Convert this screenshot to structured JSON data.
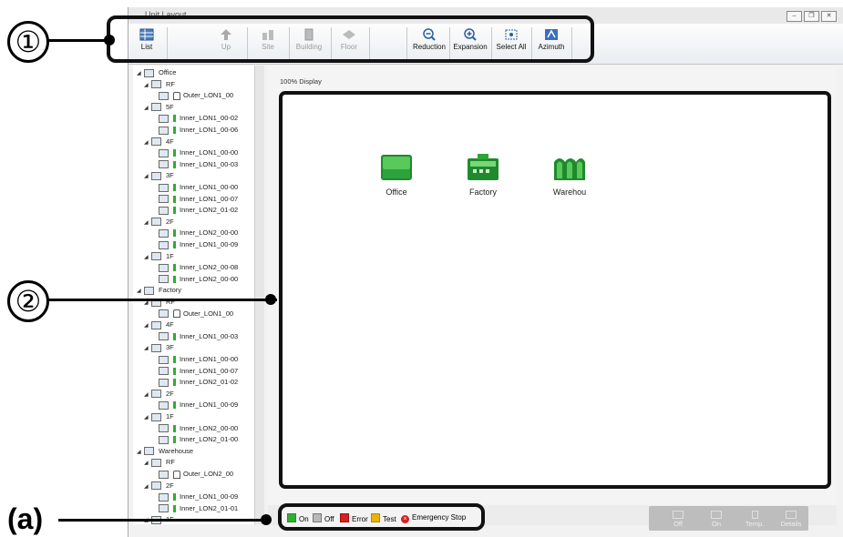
{
  "window": {
    "title": "Unit Layout",
    "controls": [
      "minimize-icon",
      "restore-icon",
      "close-icon"
    ]
  },
  "ribbon": {
    "buttons": [
      {
        "label": "List",
        "icon": "list-icon",
        "enabled": true
      },
      {
        "label": "Up",
        "icon": "up-arrow-icon",
        "enabled": false
      },
      {
        "label": "Site",
        "icon": "site-icon",
        "enabled": false
      },
      {
        "label": "Building",
        "icon": "building-icon",
        "enabled": false
      },
      {
        "label": "Floor",
        "icon": "floor-icon",
        "enabled": false
      },
      {
        "label": "Reduction",
        "icon": "zoom-out-icon",
        "enabled": true
      },
      {
        "label": "Expansion",
        "icon": "zoom-in-icon",
        "enabled": true
      },
      {
        "label": "Select All",
        "icon": "select-all-icon",
        "enabled": true
      },
      {
        "label": "Azimuth",
        "icon": "azimuth-icon",
        "enabled": true
      }
    ]
  },
  "tree": {
    "nodes": [
      {
        "label": "Office",
        "level": 0,
        "kind": "group"
      },
      {
        "label": "RF",
        "level": 1,
        "kind": "group"
      },
      {
        "label": "Outer_LON1_00",
        "level": 2,
        "kind": "outer"
      },
      {
        "label": "5F",
        "level": 1,
        "kind": "group"
      },
      {
        "label": "Inner_LON1_00-02",
        "level": 2,
        "kind": "inner"
      },
      {
        "label": "Inner_LON1_00-06",
        "level": 2,
        "kind": "inner"
      },
      {
        "label": "4F",
        "level": 1,
        "kind": "group"
      },
      {
        "label": "Inner_LON1_00-00",
        "level": 2,
        "kind": "inner"
      },
      {
        "label": "Inner_LON1_00-03",
        "level": 2,
        "kind": "inner"
      },
      {
        "label": "3F",
        "level": 1,
        "kind": "group"
      },
      {
        "label": "Inner_LON1_00-00",
        "level": 2,
        "kind": "inner"
      },
      {
        "label": "Inner_LON1_00-07",
        "level": 2,
        "kind": "inner"
      },
      {
        "label": "Inner_LON2_01-02",
        "level": 2,
        "kind": "inner"
      },
      {
        "label": "2F",
        "level": 1,
        "kind": "group"
      },
      {
        "label": "Inner_LON2_00-00",
        "level": 2,
        "kind": "inner"
      },
      {
        "label": "Inner_LON1_00-09",
        "level": 2,
        "kind": "inner"
      },
      {
        "label": "1F",
        "level": 1,
        "kind": "group"
      },
      {
        "label": "Inner_LON2_00-08",
        "level": 2,
        "kind": "inner"
      },
      {
        "label": "Inner_LON2_00-00",
        "level": 2,
        "kind": "inner"
      },
      {
        "label": "Factory",
        "level": 0,
        "kind": "group"
      },
      {
        "label": "RF",
        "level": 1,
        "kind": "group"
      },
      {
        "label": "Outer_LON1_00",
        "level": 2,
        "kind": "outer"
      },
      {
        "label": "4F",
        "level": 1,
        "kind": "group"
      },
      {
        "label": "Inner_LON1_00-03",
        "level": 2,
        "kind": "inner"
      },
      {
        "label": "3F",
        "level": 1,
        "kind": "group"
      },
      {
        "label": "Inner_LON1_00-00",
        "level": 2,
        "kind": "inner"
      },
      {
        "label": "Inner_LON1_00-07",
        "level": 2,
        "kind": "inner"
      },
      {
        "label": "Inner_LON2_01-02",
        "level": 2,
        "kind": "inner"
      },
      {
        "label": "2F",
        "level": 1,
        "kind": "group"
      },
      {
        "label": "Inner_LON1_00-09",
        "level": 2,
        "kind": "inner"
      },
      {
        "label": "1F",
        "level": 1,
        "kind": "group"
      },
      {
        "label": "Inner_LON2_00-00",
        "level": 2,
        "kind": "inner"
      },
      {
        "label": "Inner_LON2_01-00",
        "level": 2,
        "kind": "inner"
      },
      {
        "label": "Warehouse",
        "level": 0,
        "kind": "group"
      },
      {
        "label": "RF",
        "level": 1,
        "kind": "group"
      },
      {
        "label": "Outer_LON2_00",
        "level": 2,
        "kind": "outer"
      },
      {
        "label": "2F",
        "level": 1,
        "kind": "group"
      },
      {
        "label": "Inner_LON1_00-09",
        "level": 2,
        "kind": "inner"
      },
      {
        "label": "Inner_LON2_01-01",
        "level": 2,
        "kind": "inner"
      },
      {
        "label": "1F",
        "level": 1,
        "kind": "group"
      }
    ]
  },
  "main": {
    "display_label": "100% Display",
    "buildings": [
      {
        "label": "Office",
        "icon": "office-building-icon"
      },
      {
        "label": "Factory",
        "icon": "factory-icon"
      },
      {
        "label": "Warehou",
        "icon": "warehouse-icon"
      }
    ]
  },
  "legend": [
    {
      "label": "On",
      "color": "#2fae2f"
    },
    {
      "label": "Off",
      "color": "#b9b9b9"
    },
    {
      "label": "Error",
      "color": "#d42020"
    },
    {
      "label": "Test",
      "color": "#e8b400"
    },
    {
      "label": "Emergency Stop",
      "color": "#d42020",
      "icon": "emergency-stop-icon"
    }
  ],
  "controls": {
    "buttons": [
      {
        "label": "Off"
      },
      {
        "label": "On"
      },
      {
        "label": "Temp."
      },
      {
        "label": "Details"
      }
    ]
  },
  "callouts": {
    "one": "①",
    "two": "②",
    "a": "(a)"
  },
  "colors": {
    "accent_green": "#2fae2f",
    "callout_black": "#111111"
  }
}
